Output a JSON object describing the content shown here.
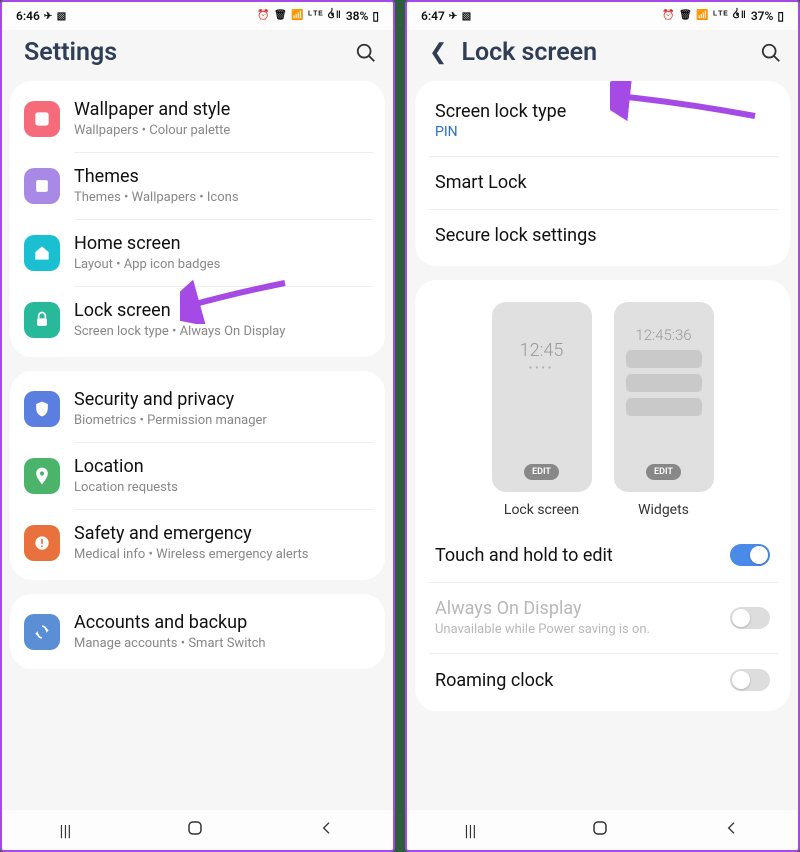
{
  "left": {
    "status": {
      "time": "6:46",
      "battery": "38%"
    },
    "header": {
      "title": "Settings"
    },
    "groups": [
      {
        "items": [
          {
            "icon": "wallpaper",
            "color": "#f56b7a",
            "title": "Wallpaper and style",
            "sub": "Wallpapers  •  Colour palette"
          },
          {
            "icon": "themes",
            "color": "#a889e6",
            "title": "Themes",
            "sub": "Themes  •  Wallpapers  •  Icons"
          },
          {
            "icon": "home",
            "color": "#1abfd1",
            "title": "Home screen",
            "sub": "Layout  •  App icon badges"
          },
          {
            "icon": "lock",
            "color": "#28b89a",
            "title": "Lock screen",
            "sub": "Screen lock type  •  Always On Display"
          }
        ]
      },
      {
        "items": [
          {
            "icon": "shield",
            "color": "#5b7fe0",
            "title": "Security and privacy",
            "sub": "Biometrics  •  Permission manager"
          },
          {
            "icon": "location",
            "color": "#4bb36a",
            "title": "Location",
            "sub": "Location requests"
          },
          {
            "icon": "safety",
            "color": "#e8713e",
            "title": "Safety and emergency",
            "sub": "Medical info  •  Wireless emergency alerts"
          }
        ]
      },
      {
        "items": [
          {
            "icon": "accounts",
            "color": "#5a8fd6",
            "title": "Accounts and backup",
            "sub": "Manage accounts  •  Smart Switch"
          }
        ]
      }
    ]
  },
  "right": {
    "status": {
      "time": "6:47",
      "battery": "37%"
    },
    "header": {
      "title": "Lock screen"
    },
    "group1": [
      {
        "title": "Screen lock type",
        "sublink": "PIN"
      },
      {
        "title": "Smart Lock"
      },
      {
        "title": "Secure lock settings"
      }
    ],
    "previews": {
      "lock": {
        "time": "12:45",
        "edit": "EDIT",
        "label": "Lock screen"
      },
      "widgets": {
        "time": "12:45:36",
        "edit": "EDIT",
        "label": "Widgets"
      }
    },
    "group2": [
      {
        "title": "Touch and hold to edit",
        "toggle": "on"
      },
      {
        "title": "Always On Display",
        "sub": "Unavailable while Power saving is on.",
        "toggle": "off",
        "disabled": true
      },
      {
        "title": "Roaming clock",
        "toggle": "off"
      }
    ]
  }
}
